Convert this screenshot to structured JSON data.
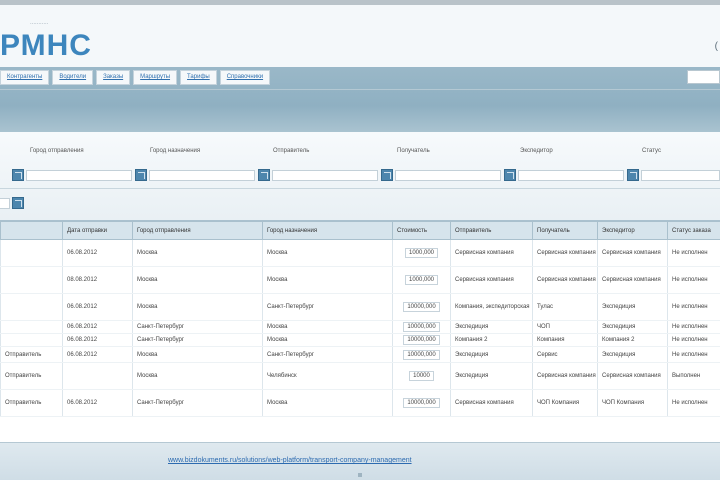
{
  "header": {
    "tagline": "...........",
    "logo": "РМНС",
    "corner": "("
  },
  "nav": {
    "tabs": [
      "Контрагенты",
      "Водители",
      "Заказы",
      "Маршруты",
      "Тарифы",
      "Справочники"
    ]
  },
  "filters": {
    "labels": [
      "Город отправления",
      "Город назначения",
      "Отправитель",
      "Получатель",
      "Экспедитор",
      "Статус"
    ]
  },
  "table": {
    "columns": [
      "",
      "Дата отправки",
      "Город отправления",
      "Город назначения",
      "Стоимость",
      "Отправитель",
      "Получатель",
      "Экспедитор",
      "Статус заказа"
    ],
    "rows": [
      [
        "",
        "06.08.2012",
        "Москва",
        "Москва",
        "1000,000",
        "Сервисная компания",
        "Сервисная компания",
        "Сервисная компания",
        "Не исполнен"
      ],
      [
        "",
        "08.08.2012",
        "Москва",
        "Москва",
        "1000,000",
        "Сервисная компания",
        "Сервисная компания",
        "Сервисная компания",
        "Не исполнен"
      ],
      [
        "",
        "06.08.2012",
        "Москва",
        "Санкт-Петербург",
        "10000,000",
        "Компания, экспедиторская",
        "Тулас",
        "Экспедиция",
        "Не исполнен"
      ],
      [
        "",
        "06.08.2012",
        "Санкт-Петербург",
        "Москва",
        "10000,000",
        "Экспедиция",
        "ЧОП",
        "Экспедиция",
        "Не исполнен"
      ],
      [
        "",
        "06.08.2012",
        "Санкт-Петербург",
        "Москва",
        "10000,000",
        "Компания 2",
        "Компания",
        "Компания 2",
        "Не исполнен"
      ],
      [
        "Отправитель",
        "06.08.2012",
        "Москва",
        "Санкт-Петербург",
        "10000,000",
        "Экспедиция",
        "Сервис",
        "Экспедиция",
        "Не исполнен"
      ],
      [
        "Отправитель",
        "",
        "Москва",
        "Челябинск",
        "10000",
        "Экспедиция",
        "Сервисная компания",
        "Сервисная компания",
        "Выполнен"
      ],
      [
        "Отправитель",
        "06.08.2012",
        "Санкт-Петербург",
        "Москва",
        "10000,000",
        "Сервисная компания",
        "ЧОП Компания",
        "ЧОП Компания",
        "Не исполнен"
      ]
    ]
  },
  "footer": {
    "link": "www.bizdokuments.ru/solutions/web-platform/transport-company-management"
  }
}
